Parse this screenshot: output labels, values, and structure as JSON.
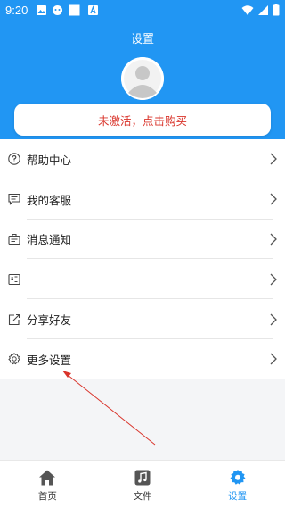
{
  "status_bar": {
    "time": "9:20"
  },
  "header": {
    "title": "设置"
  },
  "activation": {
    "text": "未激活，点击购买",
    "color": "#d9342b"
  },
  "menu": {
    "items": [
      {
        "label": "帮助中心",
        "icon": "help-circle-icon"
      },
      {
        "label": "我的客服",
        "icon": "chat-icon"
      },
      {
        "label": "消息通知",
        "icon": "notification-icon"
      },
      {
        "label": "",
        "icon": "complaint-icon"
      },
      {
        "label": "分享好友",
        "icon": "share-icon"
      },
      {
        "label": "更多设置",
        "icon": "gear-icon"
      }
    ]
  },
  "tabs": [
    {
      "label": "首页",
      "icon": "home-icon",
      "active": false
    },
    {
      "label": "文件",
      "icon": "music-file-icon",
      "active": false
    },
    {
      "label": "设置",
      "icon": "settings-gear-icon",
      "active": true
    }
  ],
  "colors": {
    "primary": "#2196f3",
    "background": "#f4f5f7",
    "arrow": "#d9342b"
  }
}
